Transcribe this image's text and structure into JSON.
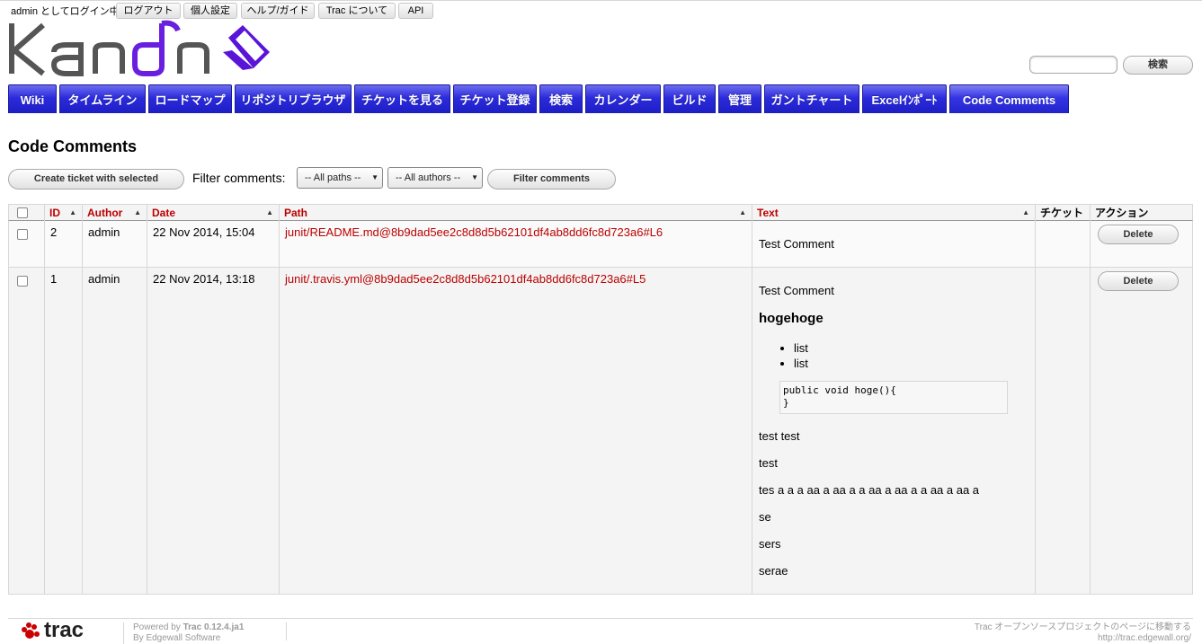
{
  "metanav": {
    "user_text": "admin としてログイン中",
    "items": [
      "ログアウト",
      "個人設定",
      "ヘルプ/ガイド",
      "Trac について",
      "API"
    ]
  },
  "logo": {
    "alt": "Kandn"
  },
  "search": {
    "value": "",
    "button": "検索"
  },
  "mainnav": {
    "tabs": [
      "Wiki",
      "タイムライン",
      "ロードマップ",
      "リポジトリブラウザ",
      "チケットを見る",
      "チケット登録",
      "検索",
      "カレンダー",
      "ビルド",
      "管理",
      "ガントチャート",
      "Excelｲﾝﾎﾟｰﾄ",
      "Code Comments"
    ],
    "active": "Code Comments"
  },
  "page": {
    "title": "Code Comments"
  },
  "filters": {
    "create_ticket_button": "Create ticket with selected",
    "label": "Filter comments:",
    "paths_select": "-- All paths --",
    "authors_select": "-- All authors --",
    "filter_button": "Filter comments"
  },
  "table": {
    "headers": {
      "id": "ID",
      "author": "Author",
      "date": "Date",
      "path": "Path",
      "text": "Text",
      "ticket": "チケット",
      "action": "アクション"
    },
    "rows": [
      {
        "id": "2",
        "author": "admin",
        "date": "22 Nov 2014, 15:04",
        "path": "junit/README.md@8b9dad5ee2c8d8d5b62101df4ab8dd6fc8d723a6#L6",
        "text": "Test Comment",
        "ticket": "",
        "action": "Delete"
      },
      {
        "id": "1",
        "author": "admin",
        "date": "22 Nov 2014, 13:18",
        "path": "junit/.travis.yml@8b9dad5ee2c8d8d5b62101df4ab8dd6fc8d723a6#L5",
        "text": "Test Comment",
        "heading": "hogehoge",
        "list": [
          "list",
          "list"
        ],
        "code": [
          "public void hoge(){",
          "}"
        ],
        "paragraphs": [
          "test test",
          "test",
          "tes a a a aa a aa a a aa a aa a a aa a aa a",
          "se",
          "sers",
          "serae"
        ],
        "ticket": "",
        "action": "Delete"
      }
    ]
  },
  "footer": {
    "powered_prefix": "Powered by",
    "powered_version": "Trac 0.12.4.ja1",
    "powered_by": "By Edgewall Software",
    "right_text": "Trac オープンソースプロジェクトのページに移動する",
    "right_url": "http://trac.edgewall.org/",
    "logo_text": "trac"
  }
}
